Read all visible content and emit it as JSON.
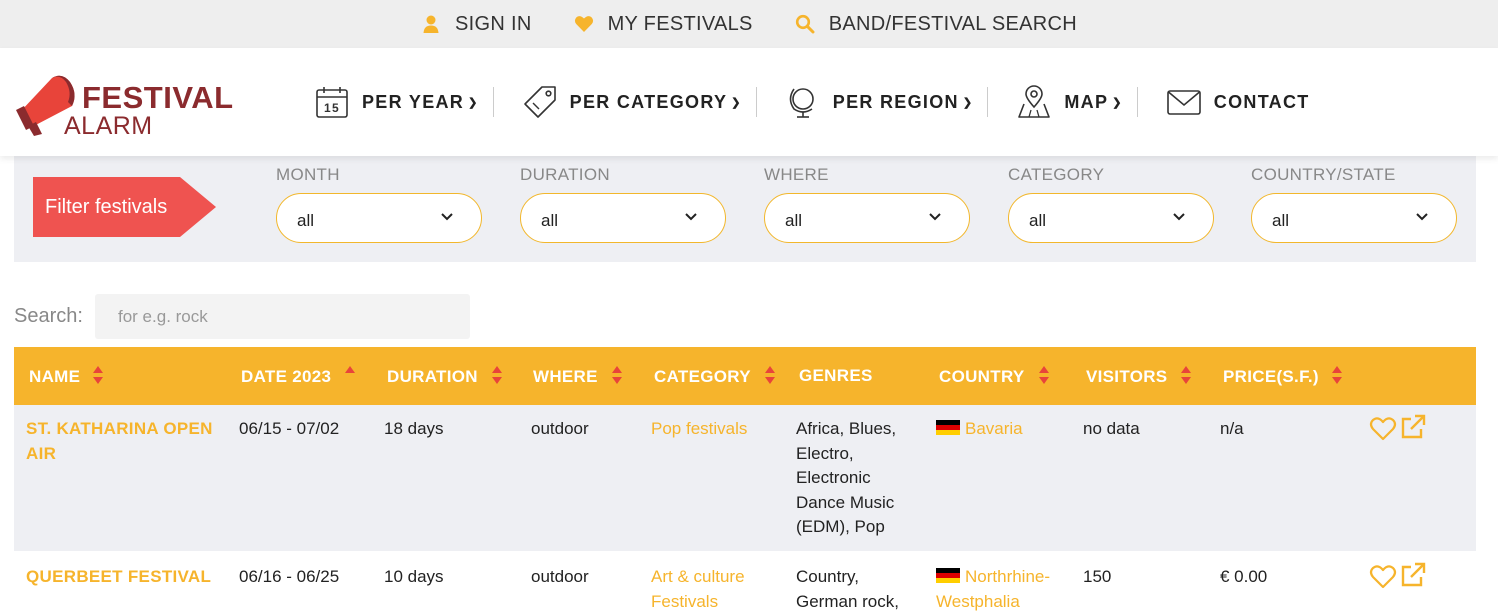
{
  "topbar": {
    "sign_in": "SIGN IN",
    "my_festivals": "MY FESTIVALS",
    "search": "BAND/FESTIVAL SEARCH"
  },
  "logo": {
    "line1": "FESTIVAL",
    "line2": "ALARM"
  },
  "nav": {
    "per_year": "PER YEAR",
    "per_year_icon_day": "15",
    "per_category": "PER CATEGORY",
    "per_region": "PER REGION",
    "map": "MAP",
    "contact": "CONTACT"
  },
  "filter": {
    "button": "Filter festivals",
    "fields": [
      {
        "label": "MONTH",
        "value": "all"
      },
      {
        "label": "DURATION",
        "value": "all"
      },
      {
        "label": "WHERE",
        "value": "all"
      },
      {
        "label": "CATEGORY",
        "value": "all"
      },
      {
        "label": "COUNTRY/STATE",
        "value": "all"
      }
    ]
  },
  "search": {
    "label": "Search:",
    "placeholder": "for e.g. rock"
  },
  "table": {
    "headers": {
      "name": "NAME",
      "date": "DATE 2023",
      "duration": "DURATION",
      "where": "WHERE",
      "category": "CATEGORY",
      "genres": "GENRES",
      "country": "COUNTRY",
      "visitors": "VISITORS",
      "price": "PRICE(S.F.)"
    },
    "rows": [
      {
        "name_l1": "ST. KATHARINA OPEN",
        "name_l2": "AIR",
        "date": "06/15 - 07/02",
        "duration": "18 days",
        "where": "outdoor",
        "category": "Pop festivals",
        "genres": [
          "Africa, Blues,",
          "Electro,",
          "Electronic",
          "Dance Music",
          "(EDM), Pop"
        ],
        "country": "Bavaria",
        "visitors": "no data",
        "price": "n/a"
      },
      {
        "name_l1": "QUERBEET FESTIVAL",
        "date": "06/16 - 06/25",
        "duration": "10 days",
        "where": "outdoor",
        "category": [
          "Art & culture",
          "Festivals"
        ],
        "genres": [
          "Country,",
          "German rock,"
        ],
        "country": [
          "Northrhine-",
          "Westphalia"
        ],
        "visitors": "150",
        "price": "€ 0.00"
      }
    ]
  },
  "colors": {
    "accent": "#f6b42c",
    "brand": "#8b2b2e",
    "filter_button": "#ef5350",
    "panel": "#eeeff3",
    "sort_arrows": "#e8443a"
  }
}
